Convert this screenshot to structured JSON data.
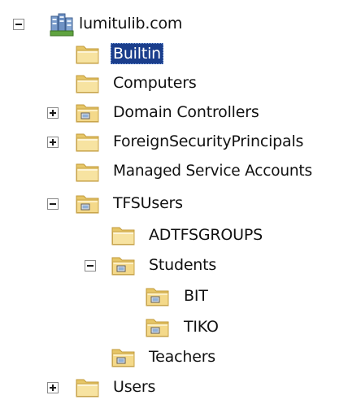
{
  "tree": {
    "root": {
      "label": "lumitulib.com",
      "expanded": true,
      "icon": "domain-icon"
    },
    "items": [
      {
        "label": "Builtin",
        "icon": "folder-icon",
        "selected": true
      },
      {
        "label": "Computers",
        "icon": "folder-icon"
      },
      {
        "label": "Domain Controllers",
        "icon": "ou-folder-icon",
        "toggle": "plus"
      },
      {
        "label": "ForeignSecurityPrincipals",
        "icon": "folder-icon",
        "toggle": "plus"
      },
      {
        "label": "Managed Service Accounts",
        "icon": "folder-icon"
      },
      {
        "label": "TFSUsers",
        "icon": "ou-folder-icon",
        "toggle": "minus",
        "children": [
          {
            "label": "ADTFSGROUPS",
            "icon": "folder-icon"
          },
          {
            "label": "Students",
            "icon": "ou-folder-icon",
            "toggle": "minus",
            "children": [
              {
                "label": "BIT",
                "icon": "ou-folder-icon"
              },
              {
                "label": "TIKO",
                "icon": "ou-folder-icon"
              }
            ]
          },
          {
            "label": "Teachers",
            "icon": "ou-folder-icon"
          }
        ]
      },
      {
        "label": "Users",
        "icon": "folder-icon",
        "toggle": "plus"
      }
    ]
  },
  "colors": {
    "selection": "#1b3e8c",
    "folder": "#f2d782",
    "folder_border": "#c9a54b"
  }
}
